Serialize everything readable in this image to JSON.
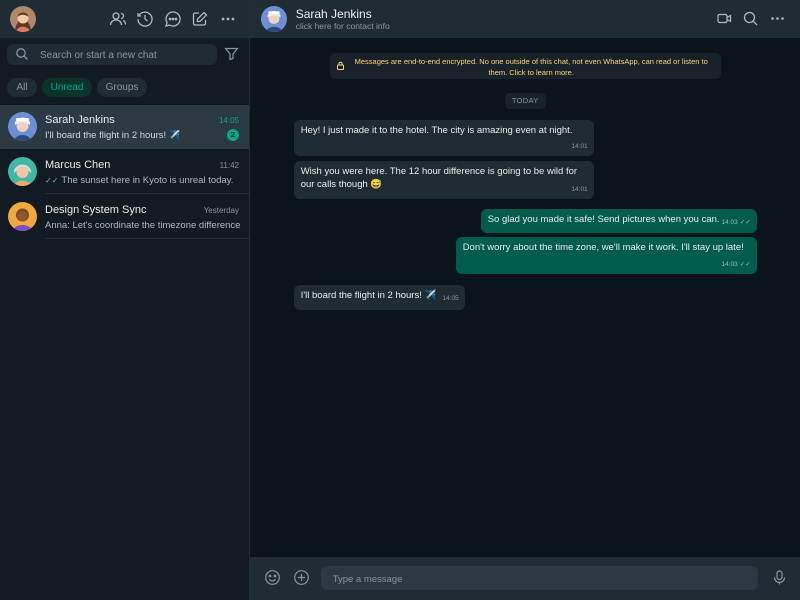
{
  "sidebar": {
    "search_placeholder": "Search or start a new chat",
    "filters": [
      {
        "label": "All"
      },
      {
        "label": "Unread"
      },
      {
        "label": "Groups"
      }
    ],
    "chats": [
      {
        "name": "Sarah Jenkins",
        "time": "14:05",
        "preview": "I'll board the flight in 2 hours! ✈️",
        "unread": "2"
      },
      {
        "name": "Marcus Chen",
        "time": "11:42",
        "preview": "The sunset here in Kyoto is unreal today."
      },
      {
        "name": "Design System Sync",
        "time": "Yesterday",
        "preview": "Anna: Let's coordinate the timezone difference."
      }
    ]
  },
  "conversation": {
    "contact_name": "Sarah Jenkins",
    "contact_subtitle": "click here for contact info",
    "encryption_notice": "Messages are end-to-end encrypted. No one outside of this chat, not even WhatsApp, can read or listen to them. Click to learn more.",
    "date_label": "TODAY",
    "messages": [
      {
        "direction": "in",
        "text": "Hey! I just made it to the hotel. The city is amazing even at night.",
        "time": "14:01"
      },
      {
        "direction": "in",
        "text": "Wish you were here. The 12 hour difference is going to be wild for our calls though 😅",
        "time": "14:01"
      },
      {
        "direction": "out",
        "text": "So glad you made it safe! Send pictures when you can.",
        "time": "14:03"
      },
      {
        "direction": "out",
        "text": "Don't worry about the time zone, we'll make it work. I'll stay up late!",
        "time": "14:03"
      },
      {
        "direction": "in",
        "text": "I'll board the flight in 2 hours! ✈️",
        "time": "14:05"
      }
    ],
    "composer_placeholder": "Type a message"
  },
  "colors": {
    "accent": "#00a884",
    "panel": "#202c33",
    "background": "#0b141a",
    "outgoing_bubble": "#005c4b",
    "incoming_bubble": "#202c33",
    "read_ticks": "#53bdeb"
  }
}
